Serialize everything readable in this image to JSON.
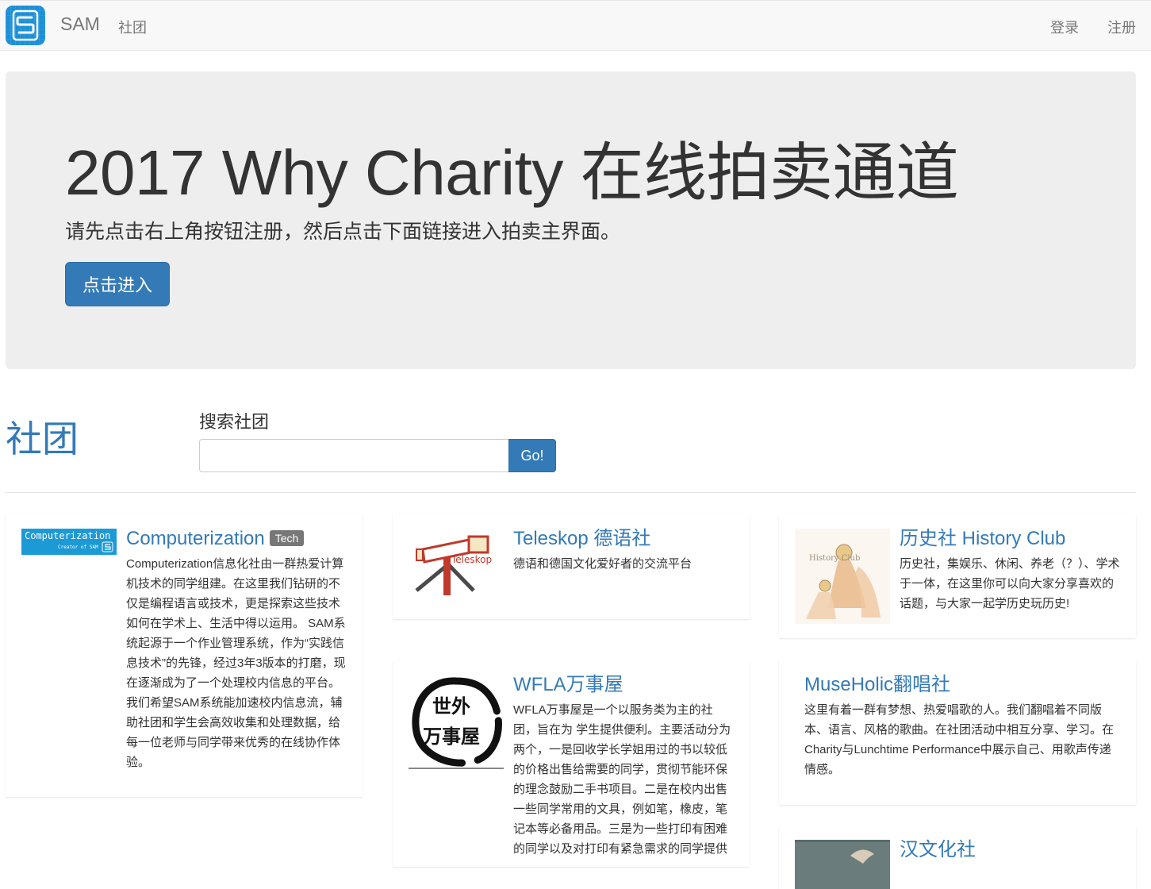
{
  "colors": {
    "primary": "#337ab7",
    "navbar_bg": "#f8f8f8",
    "jumbotron_bg": "#eeeeee",
    "badge_bg": "#777777"
  },
  "navbar": {
    "logo_icon": "sam-logo-icon",
    "brand": "SAM",
    "links": [
      "社团"
    ],
    "login": "登录",
    "register": "注册"
  },
  "jumbotron": {
    "title": "2017 Why Charity 在线拍卖通道",
    "subtitle": "请先点击右上角按钮注册，然后点击下面链接进入拍卖主界面。",
    "button": "点击进入"
  },
  "clubs_section": {
    "title": "社团",
    "search_label": "搜索社团",
    "search_value": "",
    "search_button": "Go!"
  },
  "clubs": [
    {
      "name": "Computerization",
      "badge": "Tech",
      "logo_text": "Computerization",
      "logo_subtext": "Creator of SAM",
      "description": "Computerization信息化社由一群热爱计算机技术的同学组建。在这里我们钻研的不仅是编程语言或技术，更是探索这些技术如何在学术上、生活中得以运用。 SAM系统起源于一个作业管理系统，作为“实践信息技术”的先锋，经过3年3版本的打磨，现在逐渐成为了一个处理校内信息的平台。我们希望SAM系统能加速校内信息流，辅助社团和学生会高效收集和处理数据，给每一位老师与同学带来优秀的在线协作体验。"
    },
    {
      "name": "Teleskop 德语社",
      "logo_text": "Teleskop",
      "description": "德语和德国文化爱好者的交流平台"
    },
    {
      "name": "历史社 History Club",
      "logo_text": "History Club",
      "description": "历史社，集娱乐、休闲、养老（？）、学术于一体，在这里你可以向大家分享喜欢的话题，与大家一起学历史玩历史!"
    },
    {
      "name": "WFLA万事屋",
      "logo_text_top": "世外",
      "logo_text_bottom": "万事屋",
      "description": "WFLA万事屋是一个以服务类为主的社团，旨在为 学生提供便利。主要活动分为两个，一是回收学长学姐用过的书以较低的价格出售给需要的同学，贯彻节能环保的理念鼓励二手书项目。二是在校内出售一些同学常用的文具，例如笔，橡皮，笔记本等必备用品。三是为一些打印有困难的同学以及对打印有紧急需求的同学提供"
    },
    {
      "name": "MuseHolic翻唱社",
      "description": "这里有着一群有梦想、热爱唱歌的人。我们翻唱着不同版本、语言、风格的歌曲。在社团活动中相互分享、学习。在Charity与Lunchtime Performance中展示自己、用歌声传递情感。"
    },
    {
      "name": "汉文化社"
    }
  ]
}
